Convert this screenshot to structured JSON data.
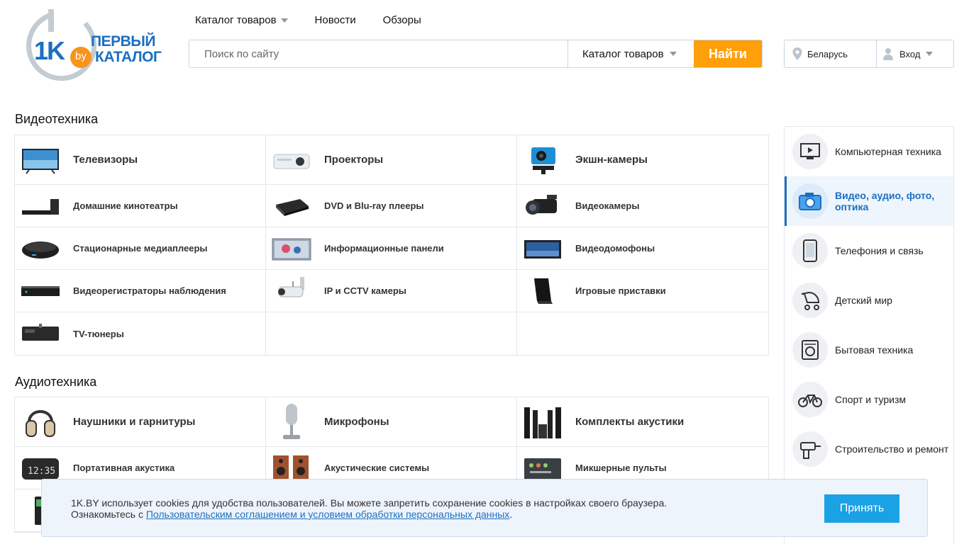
{
  "logo": {
    "brand_short": "1K",
    "brand_domain": "by",
    "line1": "ПЕРВЫЙ",
    "line2": "КАТАЛОГ"
  },
  "nav": {
    "catalog": "Каталог товаров",
    "news": "Новости",
    "reviews": "Обзоры"
  },
  "search": {
    "placeholder": "Поиск по сайту",
    "category": "Каталог товаров",
    "button": "Найти"
  },
  "region": {
    "label": "Беларусь"
  },
  "login": {
    "label": "Вход"
  },
  "video": {
    "title": "Видеотехника",
    "items": [
      "Телевизоры",
      "Проекторы",
      "Экшн-камеры",
      "Домашние кинотеатры",
      "DVD и Blu-ray плееры",
      "Видеокамеры",
      "Стационарные медиаплееры",
      "Информационные панели",
      "Видеодомофоны",
      "Видеорегистраторы наблюдения",
      "IP и CCTV камеры",
      "Игровые приставки",
      "TV-тюнеры"
    ]
  },
  "audio": {
    "title": "Аудиотехника",
    "items": [
      "Наушники и гарнитуры",
      "Микрофоны",
      "Комплекты акустики",
      "Портативная акустика",
      "Акустические системы",
      "Микшерные пульты"
    ]
  },
  "sidebar": {
    "items": [
      "Компьютерная техника",
      "Видео, аудио, фото, оптика",
      "Телефония и связь",
      "Детский мир",
      "Бытовая техника",
      "Спорт и туризм",
      "Строительство и ремонт"
    ]
  },
  "cookie": {
    "text1": "1K.BY использует cookies для удобства пользователей. Вы можете запретить сохранение cookies в настройках своего браузера.",
    "text2": "Ознакомьтесь с",
    "link": "Пользовательским соглашением и условием обработки персональных данных",
    "text3": ".",
    "accept": "Принять"
  },
  "colors": {
    "accent": "#1b6fc2",
    "search_button": "#ff9f0a",
    "accept_button": "#1aa1e6",
    "logo_gray": "#c3cbd3",
    "logo_orange": "#f7941d"
  }
}
